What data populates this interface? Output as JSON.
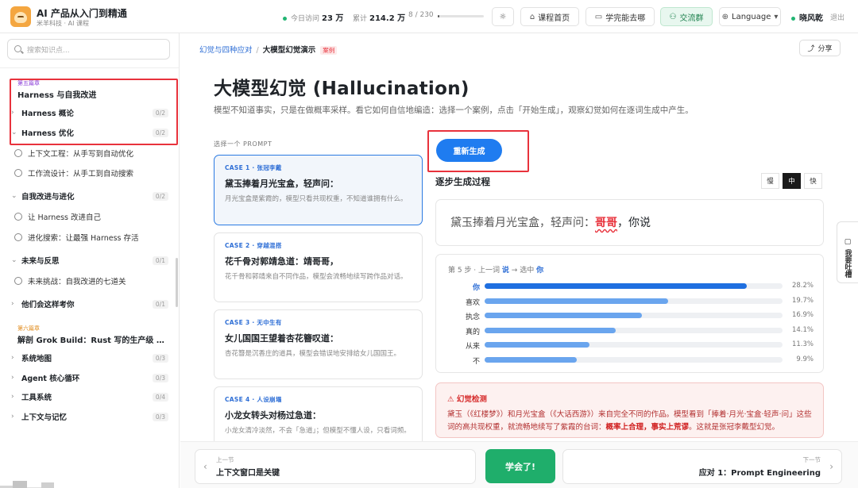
{
  "app": {
    "title": "AI 产品从入门到精通",
    "subtitle": "米羊科技 · AI 课程"
  },
  "stats": {
    "today_label": "今日访问",
    "today_value": "23 万",
    "total_label": "累计",
    "total_value": "214.2 万",
    "progress_text": "8 / 230",
    "progress_fraction": 0.035
  },
  "toolbar": {
    "course_home": "课程首页",
    "where_to_learn": "学完能去哪",
    "community": "交流群",
    "language": "Language",
    "user_name": "晓风乾",
    "logout": "退出"
  },
  "sidebar": {
    "search_placeholder": "搜索知识点...",
    "chapter5": {
      "tag": "第五篇章",
      "title": "Harness 与自我改进"
    },
    "items": [
      {
        "label": "Harness 概论",
        "count": "0/2"
      },
      {
        "label": "Harness 优化",
        "count": "0/2"
      },
      {
        "label": "上下文工程：从手写到自动优化"
      },
      {
        "label": "工作流设计：从手工到自动搜索"
      },
      {
        "label": "自我改进与进化",
        "count": "0/2"
      },
      {
        "label": "让 Harness 改进自己"
      },
      {
        "label": "进化搜索：让最强 Harness 存活"
      },
      {
        "label": "未来与反思",
        "count": "0/1"
      },
      {
        "label": "未来挑战：自我改进的七道关"
      },
      {
        "label": "他们会这样考你",
        "count": "0/1"
      }
    ],
    "chapter6": {
      "tag": "第六篇章",
      "title": "解剖 Grok Build：Rust 写的生产级 Coding Agent"
    },
    "items6": [
      {
        "label": "系统地图",
        "count": "0/3"
      },
      {
        "label": "Agent 核心循环",
        "count": "0/3"
      },
      {
        "label": "工具系统",
        "count": "0/4"
      },
      {
        "label": "上下文与记忆",
        "count": "0/3"
      }
    ]
  },
  "breadcrumb": {
    "parent": "幻觉与四种应对",
    "current": "大模型幻觉演示",
    "tag": "案例"
  },
  "share": "分享",
  "page": {
    "title": "大模型幻觉 (Hallucination)",
    "desc": "模型不知道事实，只是在做概率采样。看它如何自信地编造：选择一个案例，点击「开始生成」，观察幻觉如何在逐词生成中产生。"
  },
  "prompt_label": "选择一个 PROMPT",
  "cases": [
    {
      "id": "CASE 1 · 张冠李戴",
      "title": "黛玉捧着月光宝盒，轻声问：",
      "desc": "月光宝盒是紫霞的，模型只看共现权重，不知道谁拥有什么。"
    },
    {
      "id": "CASE 2 · 穿越混搭",
      "title": "花千骨对郭靖急道：靖哥哥，",
      "desc": "花千骨和郭靖来自不同作品，模型会流畅地续写跨作品对话。"
    },
    {
      "id": "CASE 3 · 无中生有",
      "title": "女儿国国王望着杏花簪叹道：",
      "desc": "杏花簪是沉香庄的道具，模型会错误地安排给女儿国国王。"
    },
    {
      "id": "CASE 4 · 人设崩塌",
      "title": "小龙女转头对杨过急道：",
      "desc": "小龙女清冷淡然，不会「急道」；但模型不懂人设，只看词频。"
    }
  ],
  "regen": "重新生成",
  "steps": {
    "title": "逐步生成过程",
    "speeds": [
      "慢",
      "中",
      "快"
    ],
    "active_speed": "中",
    "prompt_text": "黛玉捧着月光宝盒，轻声问：",
    "generated": "哥哥",
    "next": "，你说",
    "step_info": {
      "prefix": "第 5 步 · 上一词",
      "prev": "说",
      "arrow": "→ 选中",
      "chosen": "你"
    }
  },
  "chart_data": {
    "type": "bar",
    "categories": [
      "你",
      "喜欢",
      "执念",
      "真的",
      "从来",
      "不"
    ],
    "values": [
      28.2,
      19.7,
      16.9,
      14.1,
      11.3,
      9.9
    ],
    "labels": [
      "28.2%",
      "19.7%",
      "16.9%",
      "14.1%",
      "11.3%",
      "9.9%"
    ],
    "selected": "你",
    "xlim": [
      0,
      32
    ]
  },
  "alert": {
    "title": "⚠ 幻觉检测",
    "body": "黛玉（《红楼梦》）和月光宝盒（《大话西游》）来自完全不同的作品。模型看到「捧着·月光·宝盒·轻声·问」这些词的高共现权重，就流畅地续写了紫霞的台词：",
    "emph": "概率上合理，事实上荒谬",
    "tail": "。这就是张冠李戴型幻觉。"
  },
  "feedback": "我要吐槽",
  "bottom_nav": {
    "prev_label": "上一节",
    "prev_title": "上下文窗口是关键",
    "learned": "学会了!",
    "next_label": "下一节",
    "next_title": "应对 1：Prompt Engineering"
  }
}
